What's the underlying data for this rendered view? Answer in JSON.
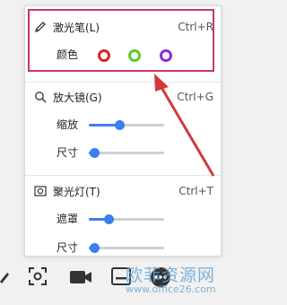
{
  "laser": {
    "title": "激光笔(L)",
    "shortcut": "Ctrl+R",
    "color_label": "颜色",
    "colors": [
      "#e02424",
      "#5acc2e",
      "#8e2ad6"
    ]
  },
  "magnifier": {
    "title": "放大镜(G)",
    "shortcut": "Ctrl+G",
    "zoom_label": "缩放",
    "zoom_level": 0.4,
    "size_label": "尺寸",
    "size_level": 0.07
  },
  "spotlight": {
    "title": "聚光灯(T)",
    "shortcut": "Ctrl+T",
    "mask_label": "遮罩",
    "mask_level": 0.26,
    "size_label": "尺寸",
    "size_level": 0.07
  },
  "toolbar": {
    "icons": [
      "pen-icon",
      "screenshot-icon",
      "camera-icon",
      "subtitle-icon",
      "more-icon"
    ]
  },
  "watermark": {
    "title": "欧菲资源网",
    "url": "www.office26.com"
  },
  "accent": "#3a7ff0",
  "highlight_color": "#c8376a"
}
